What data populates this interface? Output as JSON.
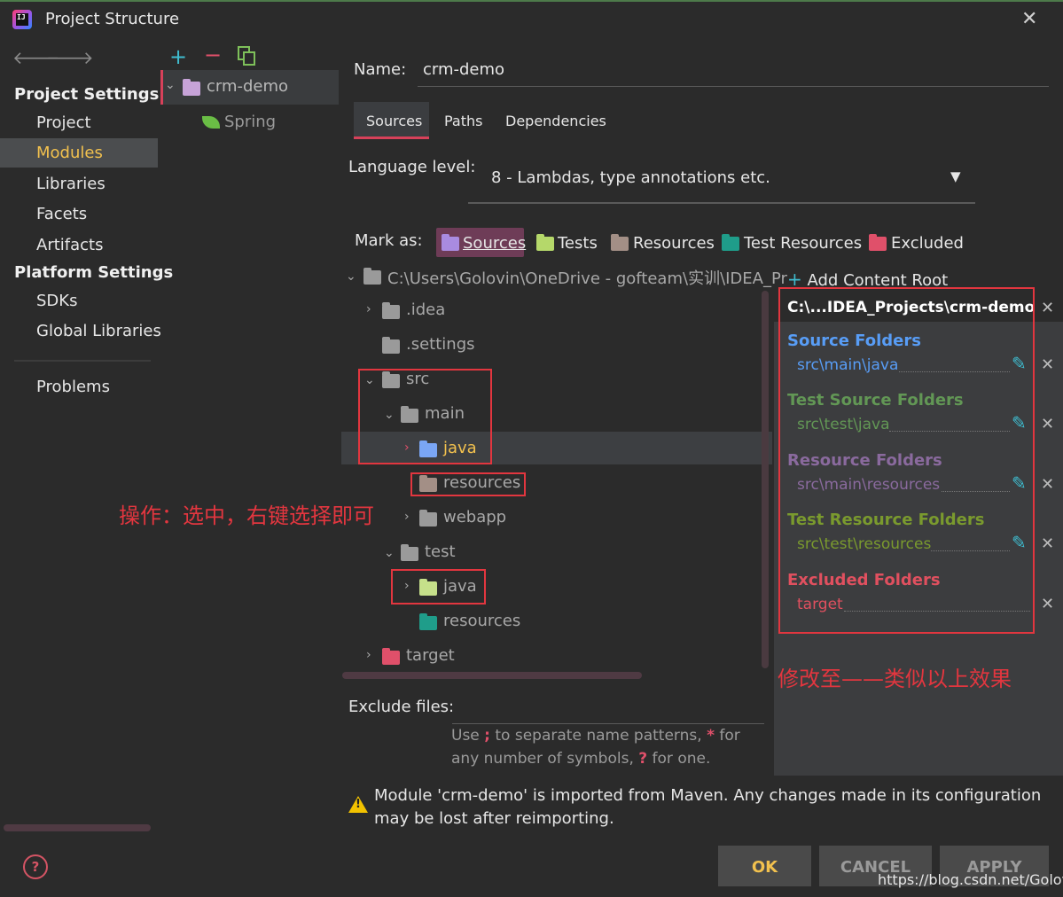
{
  "window": {
    "title": "Project Structure",
    "close_label": "✕"
  },
  "toolbar": {
    "back": "🡐",
    "forward": "🡒",
    "add": "+",
    "remove": "−"
  },
  "sidebar": {
    "project_settings": "Project Settings",
    "items_project": [
      "Project",
      "Modules",
      "Libraries",
      "Facets",
      "Artifacts"
    ],
    "platform_settings": "Platform Settings",
    "items_platform": [
      "SDKs",
      "Global Libraries"
    ],
    "problems": "Problems",
    "help": "?"
  },
  "modules": {
    "module_name": "crm-demo",
    "facet_name": "Spring"
  },
  "detail": {
    "name_label": "Name:",
    "name_value": "crm-demo",
    "tabs": [
      "Sources",
      "Paths",
      "Dependencies"
    ],
    "language_label": "Language level:",
    "language_value": "8 - Lambdas, type annotations etc.",
    "mark_label": "Mark as:",
    "mark_items": [
      "Sources",
      "Tests",
      "Resources",
      "Test Resources",
      "Excluded"
    ]
  },
  "tree": {
    "root": "C:\\Users\\Golovin\\OneDrive - gofteam\\实训\\IDEA_Pr",
    "nodes": [
      ".idea",
      ".settings",
      "src",
      "main",
      "java",
      "resources",
      "webapp",
      "test",
      "java",
      "resources",
      "target"
    ]
  },
  "annotations": {
    "left_note": "操作：选中，右键选择即可",
    "right_note": "修改至——类似以上效果"
  },
  "content_root": {
    "add_label": "Add Content Root",
    "path": "C:\\...IDEA_Projects\\crm-demo",
    "groups": [
      {
        "heading": "Source Folders",
        "path": "src\\main\\java",
        "color": "#589df6"
      },
      {
        "heading": "Test Source Folders",
        "path": "src\\test\\java",
        "color": "#629755"
      },
      {
        "heading": "Resource Folders",
        "path": "src\\main\\resources",
        "color": "#8a6a9e"
      },
      {
        "heading": "Test Resource Folders",
        "path": "src\\test\\resources",
        "color": "#7a9a2e"
      },
      {
        "heading": "Excluded Folders",
        "path": "target",
        "color": "#e0505f"
      }
    ]
  },
  "exclude": {
    "label": "Exclude files:",
    "hint_1a": "Use",
    "hint_1sep": ";",
    "hint_1b": "to separate name patterns,",
    "hint_1star": "*",
    "hint_1c": "for",
    "hint_2a": "any number of symbols,",
    "hint_2q": "?",
    "hint_2b": "for one."
  },
  "warning": "Module 'crm-demo' is imported from Maven. Any changes made in its configuration may be lost after reimporting.",
  "buttons": {
    "ok": "OK",
    "cancel": "CANCEL",
    "apply": "APPLY"
  },
  "watermark": "https://blog.csdn.net/Golovin"
}
